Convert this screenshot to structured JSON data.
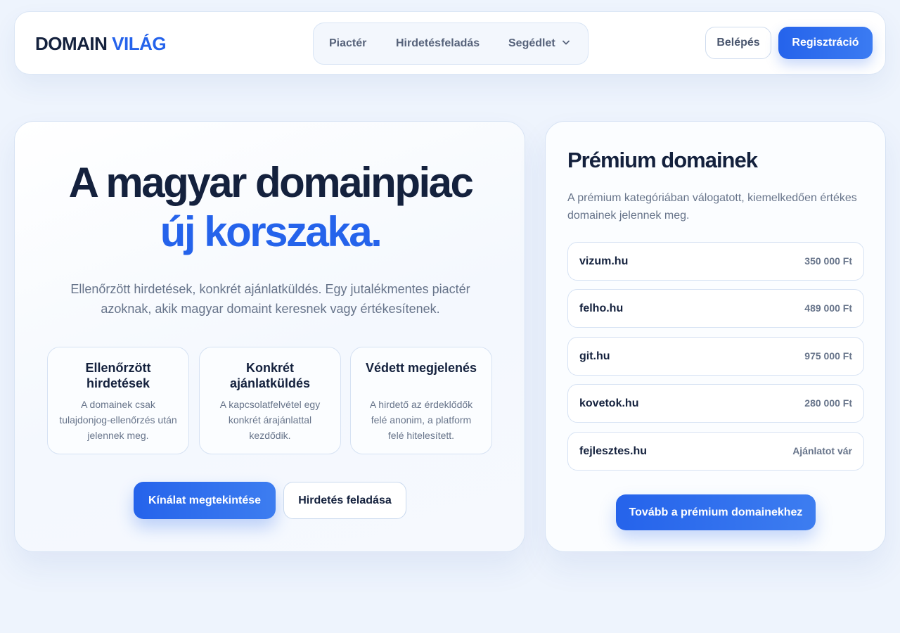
{
  "header": {
    "logo_main": "DOMAIN",
    "logo_accent": "VILÁG",
    "nav": [
      {
        "label": "Piactér"
      },
      {
        "label": "Hirdetésfeladás"
      },
      {
        "label": "Segédlet",
        "icon": "chevron-down-icon"
      }
    ],
    "login_label": "Belépés",
    "register_label": "Regisztráció"
  },
  "hero": {
    "title_line1": "A magyar domainpiac",
    "title_line2": "új korszaka.",
    "subtitle": "Ellenőrzött hirdetések, konkrét ajánlatküldés. Egy jutalékmentes piactér azoknak, akik magyar domaint keresnek vagy értékesítenek.",
    "features": [
      {
        "title": "Ellenőrzött hirdetések",
        "desc": "A domainek csak tulajdonjog-ellenőrzés után jelennek meg."
      },
      {
        "title": "Konkrét ajánlatküldés",
        "desc": "A kapcsolatfelvétel egy konkrét árajánlattal kezdődik."
      },
      {
        "title": "Védett megjelenés",
        "desc": "A hirdető az érdeklődők felé anonim, a platform felé hitelesített."
      }
    ],
    "primary_button": "Kínálat megtekintése",
    "secondary_button": "Hirdetés feladása"
  },
  "premium": {
    "title": "Prémium domainek",
    "description": "A prémium kategóriában válogatott, kiemelkedően értékes domainek jelennek meg.",
    "domains": [
      {
        "name": "vizum.hu",
        "price": "350 000 Ft"
      },
      {
        "name": "felho.hu",
        "price": "489 000 Ft"
      },
      {
        "name": "git.hu",
        "price": "975 000 Ft"
      },
      {
        "name": "kovetok.hu",
        "price": "280 000 Ft"
      },
      {
        "name": "fejlesztes.hu",
        "price": "Ajánlatot vár"
      }
    ],
    "more_button": "Tovább a prémium domainekhez"
  },
  "colors": {
    "accent": "#2563eb",
    "text_dark": "#14213d",
    "text_muted": "#67748a",
    "background": "#eef4fd"
  }
}
